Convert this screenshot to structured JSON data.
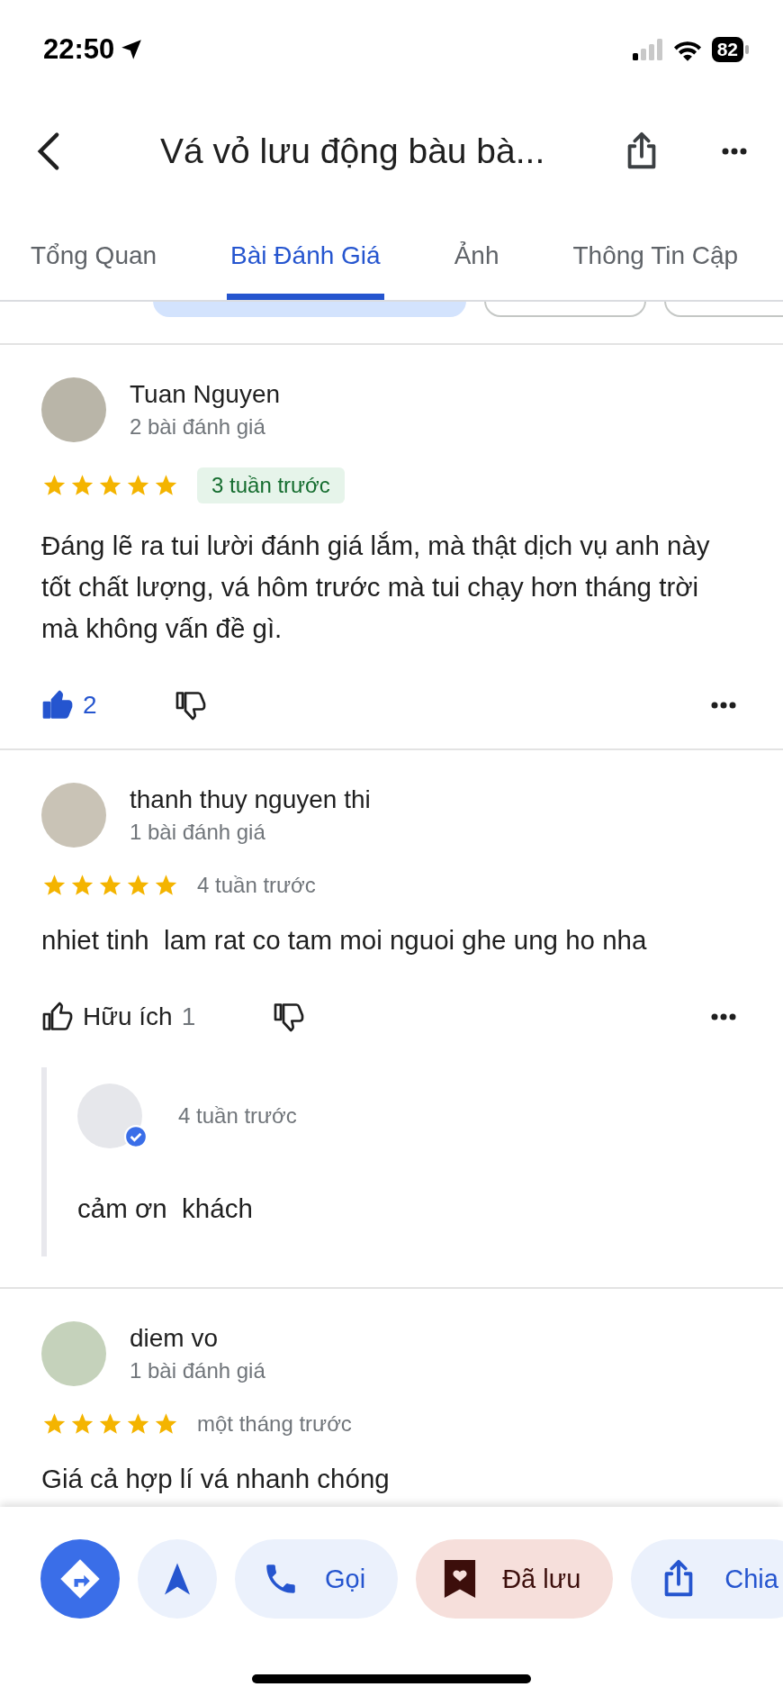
{
  "status_bar": {
    "time": "22:50",
    "battery": "82"
  },
  "header": {
    "title": "Vá vỏ lưu động bàu bà..."
  },
  "tabs": [
    {
      "label": "Tổng Quan",
      "selected": false
    },
    {
      "label": "Bài Đánh Giá",
      "selected": true
    },
    {
      "label": "Ảnh",
      "selected": false
    },
    {
      "label": "Thông Tin Cập",
      "selected": false
    }
  ],
  "filter_chips": [
    {
      "selected": true
    },
    {
      "selected": false
    },
    {
      "selected": false
    }
  ],
  "reviews": [
    {
      "name": "Tuan Nguyen",
      "review_count": "2 bài đánh giá",
      "stars": 5,
      "time": "3 tuần trước",
      "time_highlighted": true,
      "text": "Đáng lẽ ra tui lười đánh giá lắm, mà thật dịch vụ anh này tốt chất lượng, vá hôm trước mà tui chạy hơn tháng trời mà không vấn đề gì.",
      "helpful": {
        "liked": true,
        "count": "2"
      }
    },
    {
      "name": "thanh thuy nguyen thi",
      "review_count": "1 bài đánh giá",
      "stars": 5,
      "time": "4 tuần trước",
      "time_highlighted": false,
      "text": "nhiet tinh  lam rat co tam moi nguoi ghe ung ho nha",
      "helpful": {
        "liked": false,
        "label": "Hữu ích",
        "count": "1"
      },
      "reply": {
        "time": "4 tuần trước",
        "verified": true,
        "text": "cảm ơn  khách"
      }
    },
    {
      "name": "diem vo",
      "review_count": "1 bài đánh giá",
      "stars": 5,
      "time": "một tháng trước",
      "time_highlighted": false,
      "text": "Giá cả hợp lí vá nhanh chóng"
    }
  ],
  "actions": [
    {
      "kind": "directions"
    },
    {
      "kind": "start"
    },
    {
      "kind": "call",
      "label": "Gọi"
    },
    {
      "kind": "saved",
      "label": "Đã lưu"
    },
    {
      "kind": "share",
      "label": "Chia"
    }
  ]
}
